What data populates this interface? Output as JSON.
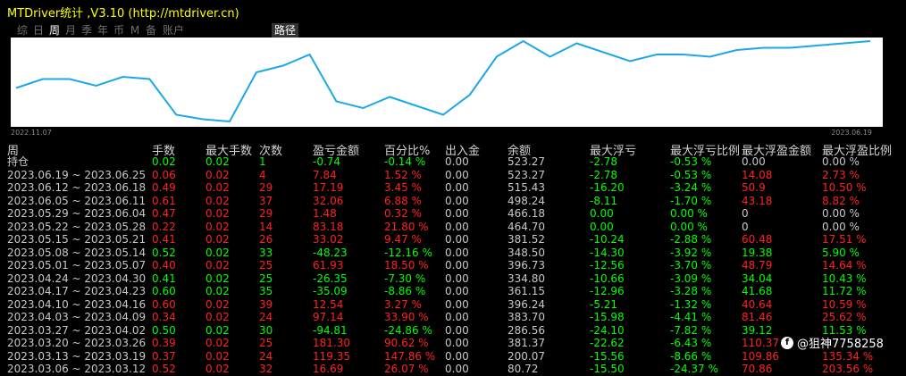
{
  "window": {
    "title": "MTDriver统计 ,V3.10 (http://mtdriver.cn)"
  },
  "tabs": [
    {
      "label": "综",
      "active": false
    },
    {
      "label": "日",
      "active": false
    },
    {
      "label": "周",
      "active": true
    },
    {
      "label": "月",
      "active": false
    },
    {
      "label": "季",
      "active": false
    },
    {
      "label": "年",
      "active": false
    },
    {
      "label": "币",
      "active": false
    },
    {
      "label": "M",
      "active": false
    },
    {
      "label": "备",
      "active": false
    },
    {
      "label": "账户",
      "active": false
    }
  ],
  "path_tab": "路径",
  "chart_dates": {
    "start": "2022.11.07",
    "end": "2023.06.19"
  },
  "chart_data": {
    "type": "line",
    "color": "#1ea7e8",
    "x": [
      "2022-11-07",
      "2022-11-14",
      "2022-11-21",
      "2022-11-28",
      "2022-12-05",
      "2022-12-12",
      "2022-12-19",
      "2022-12-26",
      "2023-01-02",
      "2023-01-09",
      "2023-01-16",
      "2023-01-23",
      "2023-01-30",
      "2023-02-06",
      "2023-02-13",
      "2023-02-20",
      "2023-02-27",
      "2023-03-06",
      "2023-03-13",
      "2023-03-20",
      "2023-03-27",
      "2023-04-03",
      "2023-04-10",
      "2023-04-17",
      "2023-04-24",
      "2023-05-01",
      "2023-05-08",
      "2023-05-15",
      "2023-05-22",
      "2023-05-29",
      "2023-06-05",
      "2023-06-12",
      "2023-06-19"
    ],
    "y": [
      92,
      96,
      96,
      93,
      97,
      96,
      80,
      78,
      77,
      99,
      102,
      107,
      86,
      83,
      88,
      84,
      80,
      89,
      106,
      113,
      106,
      112,
      108,
      104,
      107,
      107,
      106,
      109,
      110,
      110,
      111,
      112,
      113
    ]
  },
  "headers": [
    "周",
    "手数",
    "最大手数",
    "次数",
    "盈亏金额",
    "百分比%",
    "出入金",
    "余额",
    "最大浮亏",
    "最大浮亏比例",
    "最大浮盈金额",
    "最大浮盈比例"
  ],
  "holding": {
    "label": "持仓",
    "lots": "0.02",
    "max_lots": "0.02",
    "count": "1",
    "pl": "-0.74",
    "pct": "-0.14 %",
    "io": "0.00",
    "balance": "523.27",
    "max_dd": "-2.78",
    "max_dd_pct": "-0.53 %",
    "max_fp": "0.00",
    "max_fp_pct": "0.00 %"
  },
  "rows": [
    {
      "week": "2023.06.19 ~ 2023.06.25",
      "lots": "0.06",
      "max_lots": "0.02",
      "count": "4",
      "pl": "7.84",
      "pct": "1.52 %",
      "io": "0.00",
      "balance": "523.27",
      "max_dd": "-2.78",
      "max_dd_pct": "-0.53 %",
      "max_fp": "14.08",
      "max_fp_pct": "2.73 %",
      "sign": "neg"
    },
    {
      "week": "2023.06.12 ~ 2023.06.18",
      "lots": "0.49",
      "max_lots": "0.02",
      "count": "29",
      "pl": "17.19",
      "pct": "3.45 %",
      "io": "0.00",
      "balance": "515.43",
      "max_dd": "-16.20",
      "max_dd_pct": "-3.24 %",
      "max_fp": "50.9",
      "max_fp_pct": "10.50 %",
      "sign": "neg"
    },
    {
      "week": "2023.06.05 ~ 2023.06.11",
      "lots": "0.61",
      "max_lots": "0.02",
      "count": "37",
      "pl": "32.06",
      "pct": "6.88 %",
      "io": "0.00",
      "balance": "498.24",
      "max_dd": "-8.11",
      "max_dd_pct": "-1.70 %",
      "max_fp": "43.18",
      "max_fp_pct": "8.82 %",
      "sign": "neg"
    },
    {
      "week": "2023.05.29 ~ 2023.06.04",
      "lots": "0.47",
      "max_lots": "0.02",
      "count": "29",
      "pl": "1.48",
      "pct": "0.32 %",
      "io": "0.00",
      "balance": "466.18",
      "max_dd": "0.00",
      "max_dd_pct": "0.00 %",
      "max_fp": "0",
      "max_fp_pct": "0.00 %",
      "sign": "neg"
    },
    {
      "week": "2023.05.22 ~ 2023.05.28",
      "lots": "0.22",
      "max_lots": "0.02",
      "count": "14",
      "pl": "83.18",
      "pct": "21.80 %",
      "io": "0.00",
      "balance": "464.70",
      "max_dd": "0.00",
      "max_dd_pct": "0.00 %",
      "max_fp": "0",
      "max_fp_pct": "0.00 %",
      "sign": "neg"
    },
    {
      "week": "2023.05.15 ~ 2023.05.21",
      "lots": "0.41",
      "max_lots": "0.02",
      "count": "26",
      "pl": "33.02",
      "pct": "9.47 %",
      "io": "0.00",
      "balance": "381.52",
      "max_dd": "-10.24",
      "max_dd_pct": "-2.88 %",
      "max_fp": "60.48",
      "max_fp_pct": "17.51 %",
      "sign": "neg"
    },
    {
      "week": "2023.05.08 ~ 2023.05.14",
      "lots": "0.52",
      "max_lots": "0.02",
      "count": "33",
      "pl": "-48.23",
      "pct": "-12.16 %",
      "io": "0.00",
      "balance": "348.50",
      "max_dd": "-14.30",
      "max_dd_pct": "-3.92 %",
      "max_fp": "19.38",
      "max_fp_pct": "5.90 %",
      "sign": "pos"
    },
    {
      "week": "2023.05.01 ~ 2023.05.07",
      "lots": "0.40",
      "max_lots": "0.02",
      "count": "25",
      "pl": "61.93",
      "pct": "18.50 %",
      "io": "0.00",
      "balance": "396.73",
      "max_dd": "-12.56",
      "max_dd_pct": "-3.70 %",
      "max_fp": "48.79",
      "max_fp_pct": "14.64 %",
      "sign": "neg"
    },
    {
      "week": "2023.04.24 ~ 2023.04.30",
      "lots": "0.41",
      "max_lots": "0.02",
      "count": "25",
      "pl": "-26.35",
      "pct": "-7.30 %",
      "io": "0.00",
      "balance": "334.80",
      "max_dd": "-10.66",
      "max_dd_pct": "-3.09 %",
      "max_fp": "34.04",
      "max_fp_pct": "10.43 %",
      "sign": "pos"
    },
    {
      "week": "2023.04.17 ~ 2023.04.23",
      "lots": "0.60",
      "max_lots": "0.02",
      "count": "35",
      "pl": "-35.09",
      "pct": "-8.86 %",
      "io": "0.00",
      "balance": "361.15",
      "max_dd": "-12.96",
      "max_dd_pct": "-3.28 %",
      "max_fp": "41.68",
      "max_fp_pct": "11.72 %",
      "sign": "pos"
    },
    {
      "week": "2023.04.10 ~ 2023.04.16",
      "lots": "0.60",
      "max_lots": "0.02",
      "count": "39",
      "pl": "12.54",
      "pct": "3.27 %",
      "io": "0.00",
      "balance": "396.24",
      "max_dd": "-5.21",
      "max_dd_pct": "-1.32 %",
      "max_fp": "40.64",
      "max_fp_pct": "10.59 %",
      "sign": "neg"
    },
    {
      "week": "2023.04.03 ~ 2023.04.09",
      "lots": "0.34",
      "max_lots": "0.02",
      "count": "24",
      "pl": "97.14",
      "pct": "33.90 %",
      "io": "0.00",
      "balance": "383.70",
      "max_dd": "-15.98",
      "max_dd_pct": "-4.41 %",
      "max_fp": "81.46",
      "max_fp_pct": "25.62 %",
      "sign": "neg"
    },
    {
      "week": "2023.03.27 ~ 2023.04.02",
      "lots": "0.50",
      "max_lots": "0.02",
      "count": "30",
      "pl": "-94.81",
      "pct": "-24.86 %",
      "io": "0.00",
      "balance": "286.56",
      "max_dd": "-24.10",
      "max_dd_pct": "-7.82 %",
      "max_fp": "39.12",
      "max_fp_pct": "11.53 %",
      "sign": "pos"
    },
    {
      "week": "2023.03.20 ~ 2023.03.26",
      "lots": "0.39",
      "max_lots": "0.02",
      "count": "25",
      "pl": "181.30",
      "pct": "90.62 %",
      "io": "0.00",
      "balance": "381.37",
      "max_dd": "-22.62",
      "max_dd_pct": "-6.43 %",
      "max_fp": "110.37",
      "max_fp_pct": "",
      "sign": "neg"
    },
    {
      "week": "2023.03.13 ~ 2023.03.19",
      "lots": "0.37",
      "max_lots": "0.02",
      "count": "24",
      "pl": "119.35",
      "pct": "147.86 %",
      "io": "0.00",
      "balance": "200.07",
      "max_dd": "-15.56",
      "max_dd_pct": "-8.66 %",
      "max_fp": "109.86",
      "max_fp_pct": "135.34 %",
      "sign": "neg"
    },
    {
      "week": "2023.03.06 ~ 2023.03.12",
      "lots": "0.52",
      "max_lots": "0.02",
      "count": "32",
      "pl": "16.69",
      "pct": "26.07 %",
      "io": "0.00",
      "balance": "80.72",
      "max_dd": "-15.50",
      "max_dd_pct": "-24.37 %",
      "max_fp": "70.86",
      "max_fp_pct": "203.56 %",
      "sign": "neg"
    }
  ],
  "watermark": {
    "icon": "f",
    "text": "@狙神7758258"
  }
}
